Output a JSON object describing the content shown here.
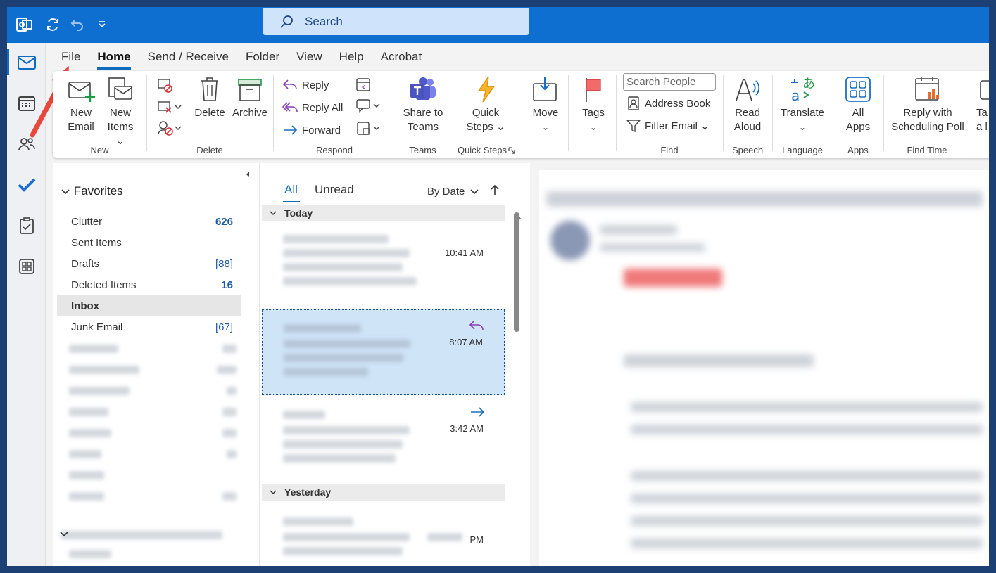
{
  "search": {
    "placeholder": "Search"
  },
  "tabs": [
    "File",
    "Home",
    "Send / Receive",
    "Folder",
    "View",
    "Help",
    "Acrobat"
  ],
  "ribbon": {
    "new": {
      "new_email": [
        "New",
        "Email"
      ],
      "new_items": [
        "New",
        "Items ⌄"
      ],
      "label": "New"
    },
    "delete": {
      "delete": "Delete",
      "archive": "Archive",
      "label": "Delete"
    },
    "respond": {
      "reply": "Reply",
      "reply_all": "Reply All",
      "forward": "Forward",
      "label": "Respond"
    },
    "teams": {
      "share": [
        "Share to",
        "Teams"
      ],
      "label": "Teams"
    },
    "quick_steps": {
      "btn": [
        "Quick",
        "Steps ⌄"
      ],
      "label": "Quick Steps"
    },
    "move": {
      "btn": "Move"
    },
    "tags": {
      "btn": "Tags"
    },
    "find": {
      "search_people": "Search People",
      "address_book": "Address Book",
      "filter_email": "Filter Email ⌄",
      "label": "Find"
    },
    "speech": {
      "btn": [
        "Read",
        "Aloud"
      ],
      "label": "Speech"
    },
    "language": {
      "btn": "Translate",
      "label": "Language"
    },
    "apps": {
      "btn": [
        "All",
        "Apps"
      ],
      "label": "Apps"
    },
    "find_time": {
      "btn": [
        "Reply with",
        "Scheduling Poll"
      ],
      "label": "Find Time"
    },
    "overflow": [
      "Ta",
      "a l"
    ]
  },
  "favorites": {
    "title": "Favorites",
    "items": [
      {
        "name": "Clutter",
        "count": "626"
      },
      {
        "name": "Sent Items",
        "count": ""
      },
      {
        "name": "Drafts",
        "count": "[88]"
      },
      {
        "name": "Deleted Items",
        "count": "16"
      },
      {
        "name": "Inbox",
        "count": ""
      },
      {
        "name": "Junk Email",
        "count": "[67]"
      }
    ]
  },
  "message_list": {
    "tab_all": "All",
    "tab_unread": "Unread",
    "sort": "By Date",
    "groups": [
      "Today",
      "Yesterday"
    ],
    "times": [
      "10:41 AM",
      "8:07 AM",
      "3:42 AM",
      "PM"
    ]
  },
  "colors": {
    "accent": "#0f6fd1",
    "selected": "#cfe4f7",
    "count": "#1f5aa6"
  }
}
